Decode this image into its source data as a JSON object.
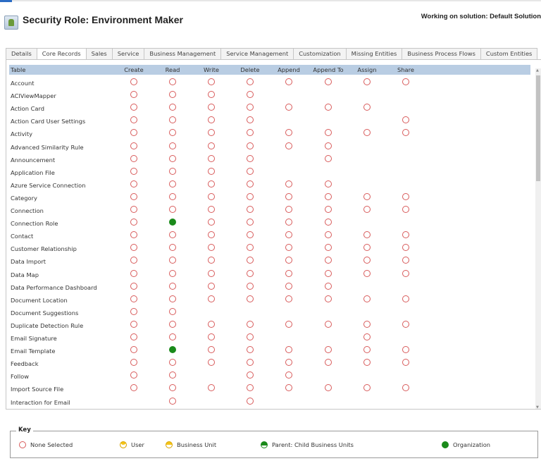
{
  "header": {
    "title": "Security Role: Environment Maker",
    "solution": "Working on solution: Default Solution"
  },
  "tabs": [
    {
      "label": "Details",
      "selected": false
    },
    {
      "label": "Core Records",
      "selected": true
    },
    {
      "label": "Sales",
      "selected": false
    },
    {
      "label": "Service",
      "selected": false
    },
    {
      "label": "Business Management",
      "selected": false
    },
    {
      "label": "Service Management",
      "selected": false
    },
    {
      "label": "Customization",
      "selected": false
    },
    {
      "label": "Missing Entities",
      "selected": false
    },
    {
      "label": "Business Process Flows",
      "selected": false
    },
    {
      "label": "Custom Entities",
      "selected": false
    }
  ],
  "table": {
    "columns": [
      "Table",
      "Create",
      "Read",
      "Write",
      "Delete",
      "Append",
      "Append To",
      "Assign",
      "Share"
    ],
    "rows": [
      {
        "name": "Account",
        "cells": [
          "none",
          "none",
          "none",
          "none",
          "none",
          "none",
          "none",
          "none"
        ]
      },
      {
        "name": "ACIViewMapper",
        "cells": [
          "none",
          "none",
          "none",
          "none",
          "",
          "",
          "",
          ""
        ]
      },
      {
        "name": "Action Card",
        "cells": [
          "none",
          "none",
          "none",
          "none",
          "none",
          "none",
          "none",
          ""
        ]
      },
      {
        "name": "Action Card User Settings",
        "cells": [
          "none",
          "none",
          "none",
          "none",
          "",
          "",
          "",
          "none"
        ]
      },
      {
        "name": "Activity",
        "cells": [
          "none",
          "none",
          "none",
          "none",
          "none",
          "none",
          "none",
          "none"
        ]
      },
      {
        "name": "Advanced Similarity Rule",
        "cells": [
          "none",
          "none",
          "none",
          "none",
          "none",
          "none",
          "",
          ""
        ]
      },
      {
        "name": "Announcement",
        "cells": [
          "none",
          "none",
          "none",
          "none",
          "",
          "none",
          "",
          ""
        ]
      },
      {
        "name": "Application File",
        "cells": [
          "none",
          "none",
          "none",
          "none",
          "",
          "",
          "",
          ""
        ]
      },
      {
        "name": "Azure Service Connection",
        "cells": [
          "none",
          "none",
          "none",
          "none",
          "none",
          "none",
          "",
          ""
        ]
      },
      {
        "name": "Category",
        "cells": [
          "none",
          "none",
          "none",
          "none",
          "none",
          "none",
          "none",
          "none"
        ]
      },
      {
        "name": "Connection",
        "cells": [
          "none",
          "none",
          "none",
          "none",
          "none",
          "none",
          "none",
          "none"
        ]
      },
      {
        "name": "Connection Role",
        "cells": [
          "none",
          "org",
          "none",
          "none",
          "none",
          "none",
          "",
          ""
        ]
      },
      {
        "name": "Contact",
        "cells": [
          "none",
          "none",
          "none",
          "none",
          "none",
          "none",
          "none",
          "none"
        ]
      },
      {
        "name": "Customer Relationship",
        "cells": [
          "none",
          "none",
          "none",
          "none",
          "none",
          "none",
          "none",
          "none"
        ]
      },
      {
        "name": "Data Import",
        "cells": [
          "none",
          "none",
          "none",
          "none",
          "none",
          "none",
          "none",
          "none"
        ]
      },
      {
        "name": "Data Map",
        "cells": [
          "none",
          "none",
          "none",
          "none",
          "none",
          "none",
          "none",
          "none"
        ]
      },
      {
        "name": "Data Performance Dashboard",
        "cells": [
          "none",
          "none",
          "none",
          "none",
          "none",
          "none",
          "",
          ""
        ]
      },
      {
        "name": "Document Location",
        "cells": [
          "none",
          "none",
          "none",
          "none",
          "none",
          "none",
          "none",
          "none"
        ]
      },
      {
        "name": "Document Suggestions",
        "cells": [
          "none",
          "none",
          "",
          "",
          "",
          "",
          "",
          ""
        ]
      },
      {
        "name": "Duplicate Detection Rule",
        "cells": [
          "none",
          "none",
          "none",
          "none",
          "none",
          "none",
          "none",
          "none"
        ]
      },
      {
        "name": "Email Signature",
        "cells": [
          "none",
          "none",
          "none",
          "none",
          "",
          "",
          "none",
          ""
        ]
      },
      {
        "name": "Email Template",
        "cells": [
          "none",
          "org",
          "none",
          "none",
          "none",
          "none",
          "none",
          "none"
        ]
      },
      {
        "name": "Feedback",
        "cells": [
          "none",
          "none",
          "none",
          "none",
          "none",
          "none",
          "none",
          "none"
        ]
      },
      {
        "name": "Follow",
        "cells": [
          "none",
          "none",
          "",
          "none",
          "none",
          "",
          "",
          ""
        ]
      },
      {
        "name": "Import Source File",
        "cells": [
          "none",
          "none",
          "none",
          "none",
          "none",
          "none",
          "none",
          "none"
        ]
      },
      {
        "name": "Interaction for Email",
        "cells": [
          "",
          "none",
          "",
          "none",
          "",
          "",
          "",
          ""
        ]
      }
    ]
  },
  "key": {
    "title": "Key",
    "items": [
      {
        "label": "None Selected",
        "icon": "none"
      },
      {
        "label": "User",
        "icon": "user"
      },
      {
        "label": "Business Unit",
        "icon": "bu"
      },
      {
        "label": "Parent: Child Business Units",
        "icon": "pc"
      },
      {
        "label": "Organization",
        "icon": "org"
      }
    ]
  },
  "colors": {
    "none": "#d85b5b",
    "organization": "#1a8a1a",
    "user": "#f5c518",
    "header_row": "#b9cde3"
  }
}
